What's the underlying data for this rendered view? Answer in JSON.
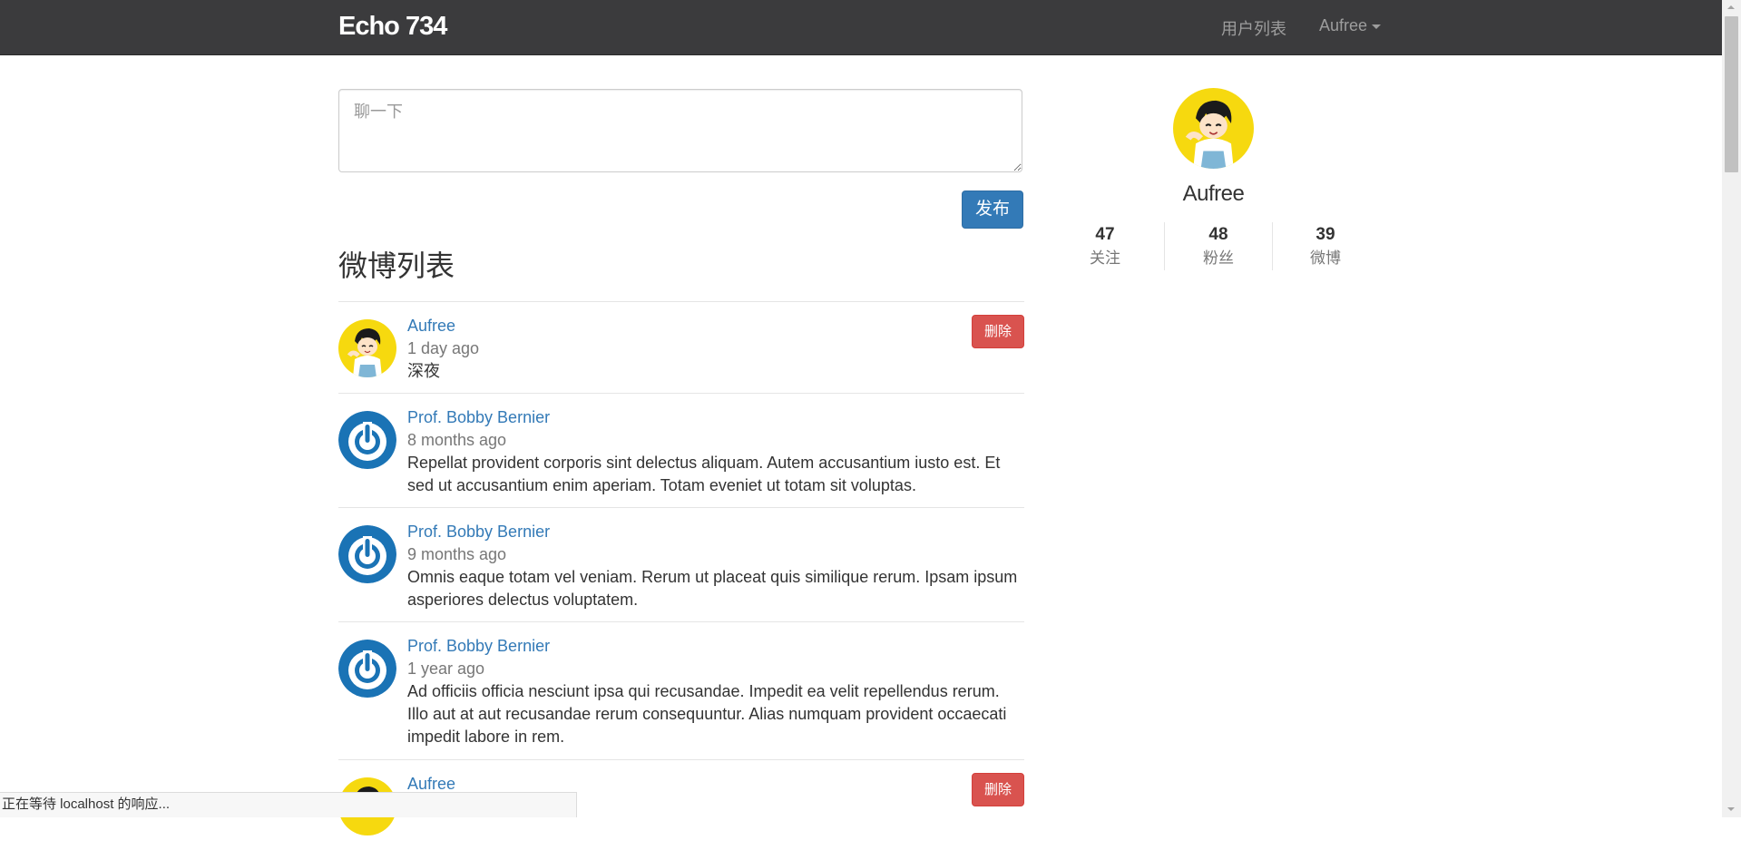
{
  "navbar": {
    "brand": "Echo 734",
    "users_link": "用户列表",
    "user_menu": "Aufree"
  },
  "composer": {
    "placeholder": "聊一下",
    "submit_label": "发布"
  },
  "feed": {
    "title": "微博列表",
    "delete_label": "删除",
    "items": [
      {
        "author": "Aufree",
        "time": "1 day ago",
        "content": "深夜",
        "avatar": "anime-avatar"
      },
      {
        "author": "Prof. Bobby Bernier",
        "time": "8 months ago",
        "content": "Repellat provident corporis sint delectus aliquam. Autem accusantium iusto est. Et sed ut accusantium enim aperiam. Totam eveniet ut totam sit voluptas.",
        "avatar": "power-icon-avatar"
      },
      {
        "author": "Prof. Bobby Bernier",
        "time": "9 months ago",
        "content": "Omnis eaque totam vel veniam. Rerum ut placeat quis similique rerum. Ipsam ipsum asperiores delectus voluptatem.",
        "avatar": "power-icon-avatar"
      },
      {
        "author": "Prof. Bobby Bernier",
        "time": "1 year ago",
        "content": "Ad officiis officia nesciunt ipsa qui recusandae. Impedit ea velit repellendus rerum. Illo aut at aut recusandae rerum consequuntur. Alias numquam provident occaecati impedit labore in rem.",
        "avatar": "power-icon-avatar"
      },
      {
        "author": "Aufree",
        "time": "",
        "content": "",
        "avatar": "anime-avatar"
      }
    ]
  },
  "profile": {
    "name": "Aufree",
    "stats": [
      {
        "count": "47",
        "label": "关注"
      },
      {
        "count": "48",
        "label": "粉丝"
      },
      {
        "count": "39",
        "label": "微博"
      }
    ]
  },
  "status_bar": {
    "text": "正在等待 localhost 的响应..."
  },
  "colors": {
    "navbar_bg": "#3b3b3d",
    "link": "#337ab7",
    "primary": "#337ab7",
    "danger": "#d9534f",
    "muted": "#777777",
    "power_avatar": "#1a73b5",
    "anime_avatar_bg": "#f6d90f"
  }
}
